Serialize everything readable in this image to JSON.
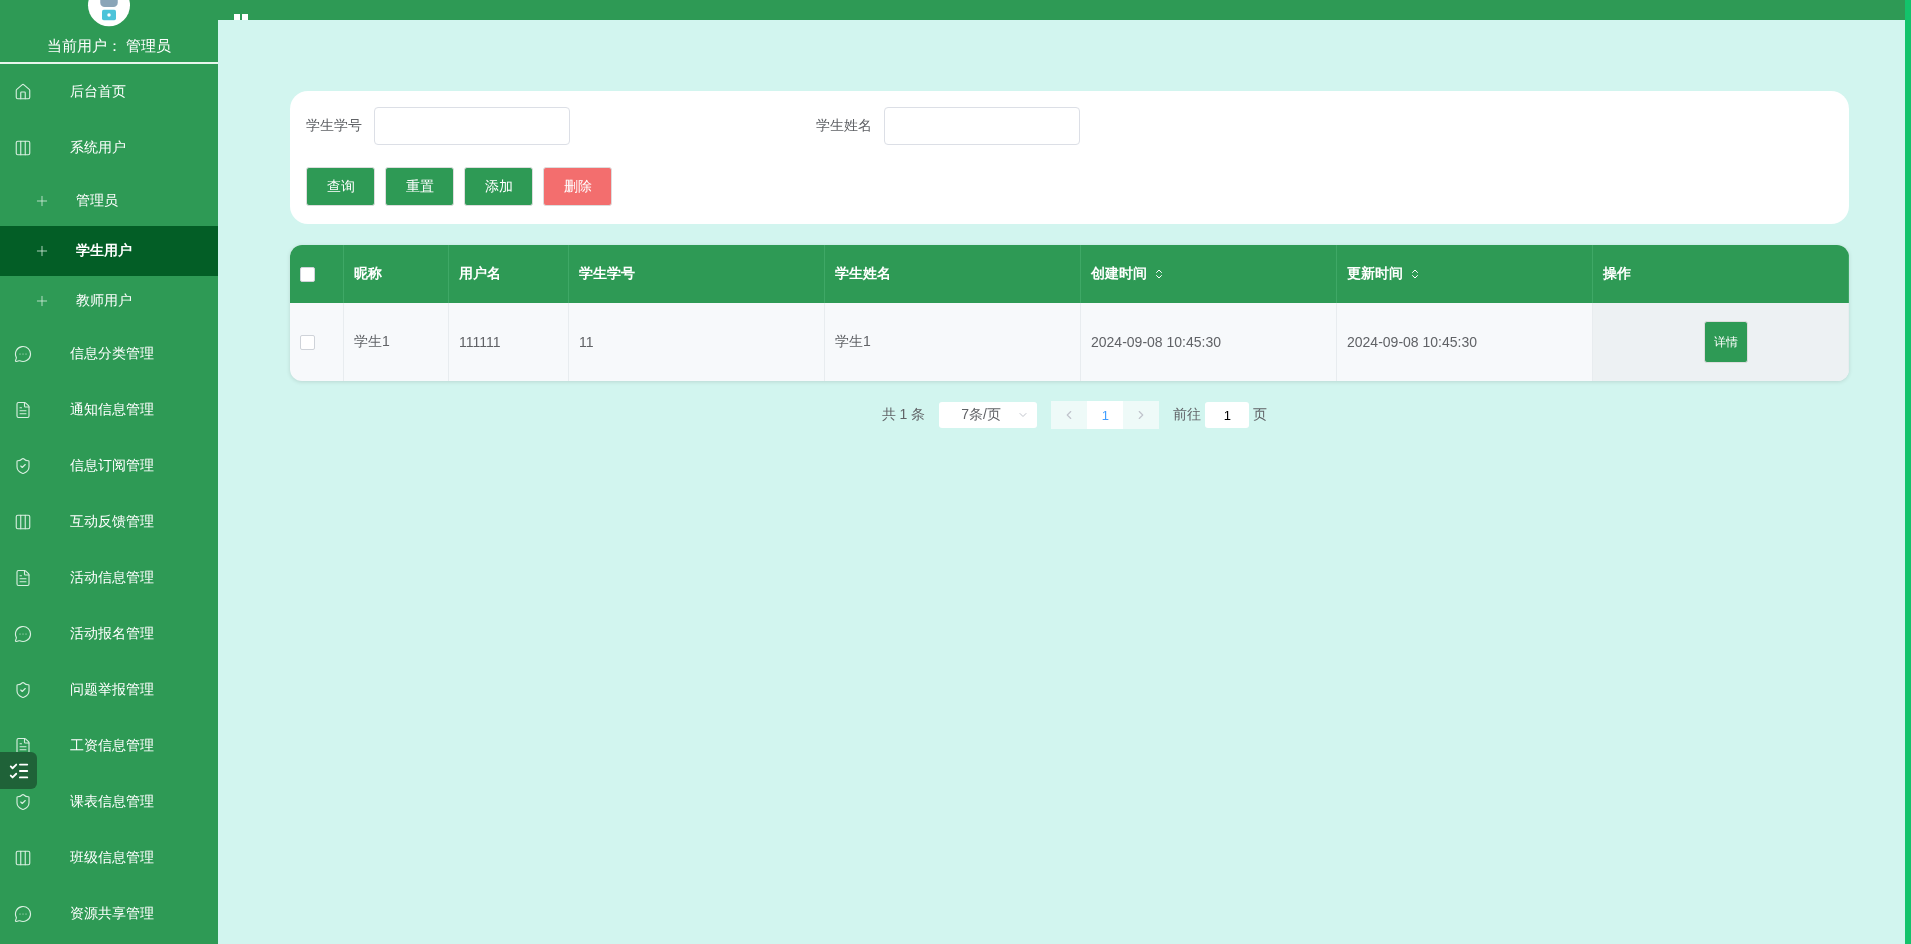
{
  "sidebar": {
    "current_user_label": "当前用户：",
    "current_user": "管理员",
    "items": [
      {
        "label": "后台首页",
        "kind": "home",
        "selected": false
      },
      {
        "label": "系统用户",
        "kind": "columns",
        "selected": false,
        "children": [
          {
            "label": "管理员",
            "selected": false
          },
          {
            "label": "学生用户",
            "selected": true
          },
          {
            "label": "教师用户",
            "selected": false
          }
        ]
      },
      {
        "label": "信息分类管理",
        "kind": "chat",
        "selected": false
      },
      {
        "label": "通知信息管理",
        "kind": "doc",
        "selected": false
      },
      {
        "label": "信息订阅管理",
        "kind": "shield",
        "selected": false
      },
      {
        "label": "互动反馈管理",
        "kind": "columns",
        "selected": false
      },
      {
        "label": "活动信息管理",
        "kind": "doc",
        "selected": false
      },
      {
        "label": "活动报名管理",
        "kind": "chat",
        "selected": false
      },
      {
        "label": "问题举报管理",
        "kind": "shield",
        "selected": false
      },
      {
        "label": "工资信息管理",
        "kind": "doc",
        "selected": false
      },
      {
        "label": "课表信息管理",
        "kind": "shield",
        "selected": false
      },
      {
        "label": "班级信息管理",
        "kind": "columns",
        "selected": false
      },
      {
        "label": "资源共享管理",
        "kind": "chat",
        "selected": false
      }
    ]
  },
  "search": {
    "fields": [
      {
        "label": "学生学号"
      },
      {
        "label": "学生姓名"
      }
    ],
    "buttons": [
      {
        "label": "查询",
        "kind": "primary"
      },
      {
        "label": "重置",
        "kind": "primary"
      },
      {
        "label": "添加",
        "kind": "primary"
      },
      {
        "label": "删除",
        "kind": "danger"
      }
    ]
  },
  "table": {
    "select_all": {
      "checked": false
    },
    "columns": [
      {
        "label": "昵称",
        "sortable": false
      },
      {
        "label": "用户名",
        "sortable": false
      },
      {
        "label": "学生学号",
        "sortable": false
      },
      {
        "label": "学生姓名",
        "sortable": false
      },
      {
        "label": "创建时间",
        "sortable": true
      },
      {
        "label": "更新时间",
        "sortable": true
      },
      {
        "label": "操作",
        "sortable": false
      }
    ],
    "rows": [
      {
        "checked": false,
        "cells": [
          "学生1",
          "111111",
          "11",
          "学生1",
          "2024-09-08 10:45:30",
          "2024-09-08 10:45:30"
        ],
        "action": "详情"
      }
    ]
  },
  "pagination": {
    "total": "共 1 条",
    "page_size": "7条/页",
    "pages": [
      {
        "label": "1",
        "selected": true
      }
    ],
    "goto_label": "前往",
    "goto_value": "1",
    "goto_suffix": "页"
  }
}
